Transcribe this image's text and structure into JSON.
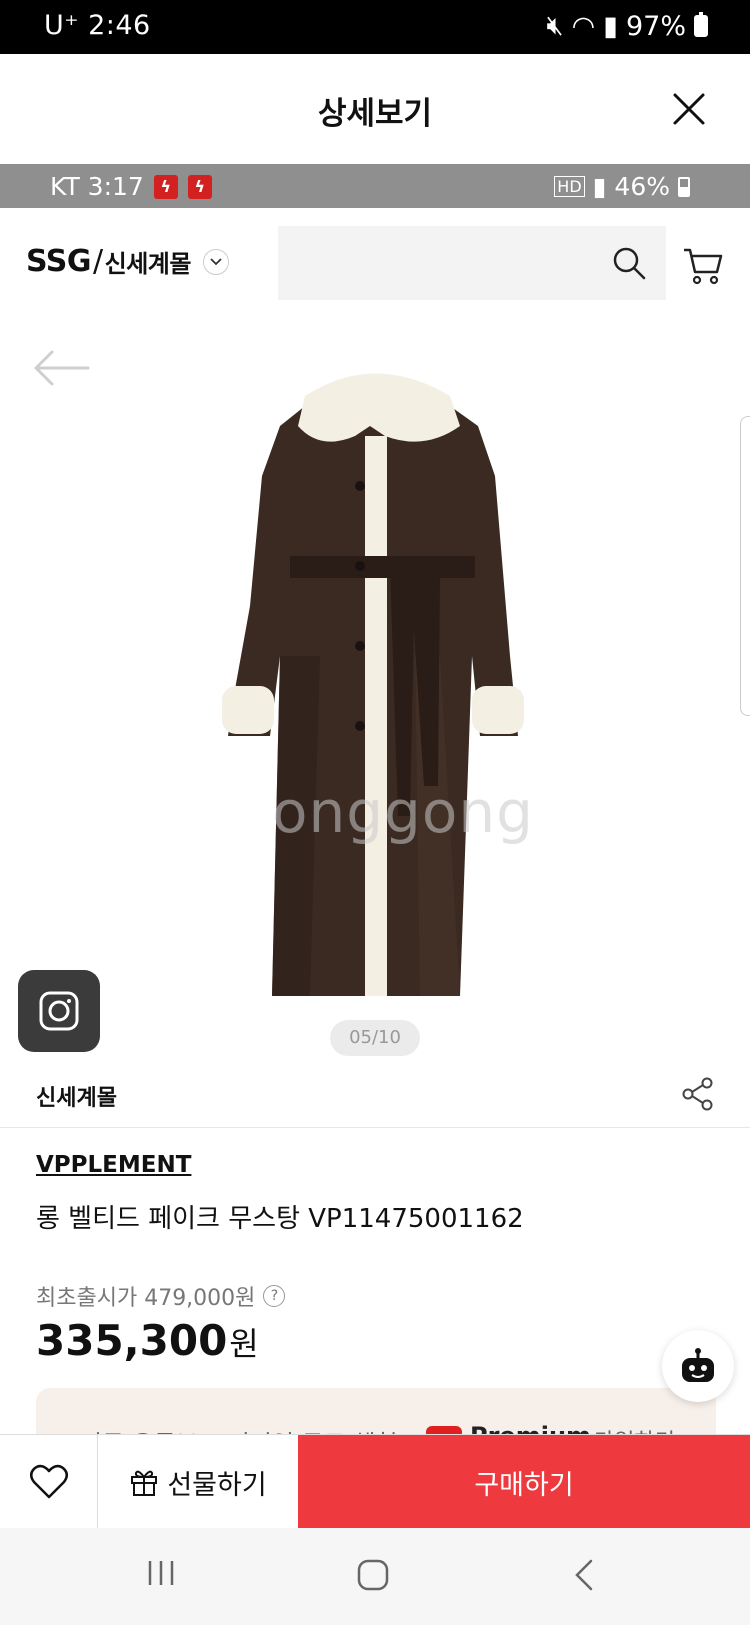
{
  "status_bar": {
    "carrier_time": "U⁺ 2:46",
    "battery": "97%"
  },
  "header": {
    "title": "상세보기"
  },
  "inner_status": {
    "carrier_time": "KT 3:17",
    "battery": "46%"
  },
  "ssg": {
    "logo_main": "SSG",
    "logo_slash": "/",
    "logo_sub": "신세계몰"
  },
  "gallery": {
    "counter": "05/10",
    "watermark": "onggong"
  },
  "seller": {
    "name": "신세계몰"
  },
  "product": {
    "brand": "VPPLEMENT",
    "name": "롱 벨티드 페이크 무스탕 VP11475001162",
    "original_price_label": "최초출시가 479,000원",
    "price": "335,300",
    "price_unit": "원"
  },
  "promo": {
    "text": "지금 유튜브 프리미엄 무료 체험",
    "premium": "Premium",
    "cta": "가입하기 ›"
  },
  "actions": {
    "gift_label": "선물하기",
    "buy_label": "구매하기"
  },
  "colors": {
    "buy": "#ee3a3f",
    "coat": "#3b2a22",
    "fur": "#f4efe3"
  }
}
